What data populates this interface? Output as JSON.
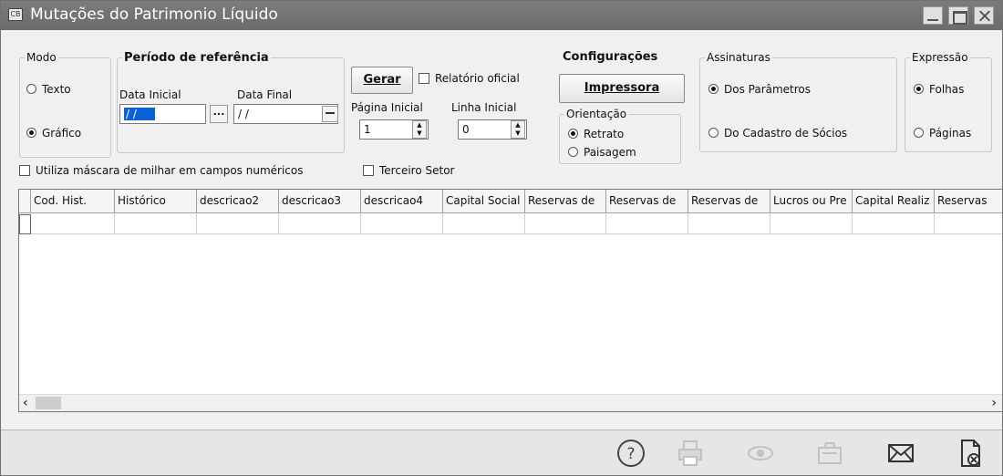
{
  "window": {
    "title": "Mutações do Patrimonio Líquido",
    "icon_text": "CB"
  },
  "modo": {
    "legend": "Modo",
    "options": [
      "Texto",
      "Gráfico"
    ],
    "selected": "Gráfico"
  },
  "periodo": {
    "legend": "Período de referência",
    "data_inicial_label": "Data Inicial",
    "data_inicial_value": "/ /",
    "data_final_label": "Data Final",
    "data_final_value": "/ /",
    "dots": "..."
  },
  "actions": {
    "gerar_label": "Gerar",
    "relatorio_oficial_label": "Relatório oficial",
    "pagina_inicial_label": "Página Inicial",
    "pagina_inicial_value": "1",
    "linha_inicial_label": "Linha Inicial",
    "linha_inicial_value": "0"
  },
  "configuracoes": {
    "legend": "Configurações",
    "impressora_label": "Impressora",
    "orientacao_legend": "Orientação",
    "orientacao_options": [
      "Retrato",
      "Paisagem"
    ],
    "orientacao_selected": "Retrato"
  },
  "assinaturas": {
    "legend": "Assinaturas",
    "options": [
      "Dos Parâmetros",
      "Do Cadastro de Sócios"
    ],
    "selected": "Dos Parâmetros"
  },
  "expressao": {
    "legend": "Expressão",
    "options": [
      "Folhas",
      "Páginas"
    ],
    "selected": "Folhas"
  },
  "checkboxes": {
    "mascara_label": "Utiliza máscara de milhar em campos numéricos",
    "terceiro_setor_label": "Terceiro Setor"
  },
  "grid": {
    "columns": [
      "Cod. Hist.",
      "Histórico",
      "descricao2",
      "descricao3",
      "descricao4",
      "Capital Social",
      "Reservas de",
      "Reservas de",
      "Reservas de",
      "Lucros ou Pre",
      "Capital Realiz",
      "Reservas"
    ]
  },
  "toolbar": {
    "icons": [
      "help-icon",
      "print-icon",
      "preview-icon",
      "export-icon",
      "email-icon",
      "close-report-icon"
    ]
  }
}
